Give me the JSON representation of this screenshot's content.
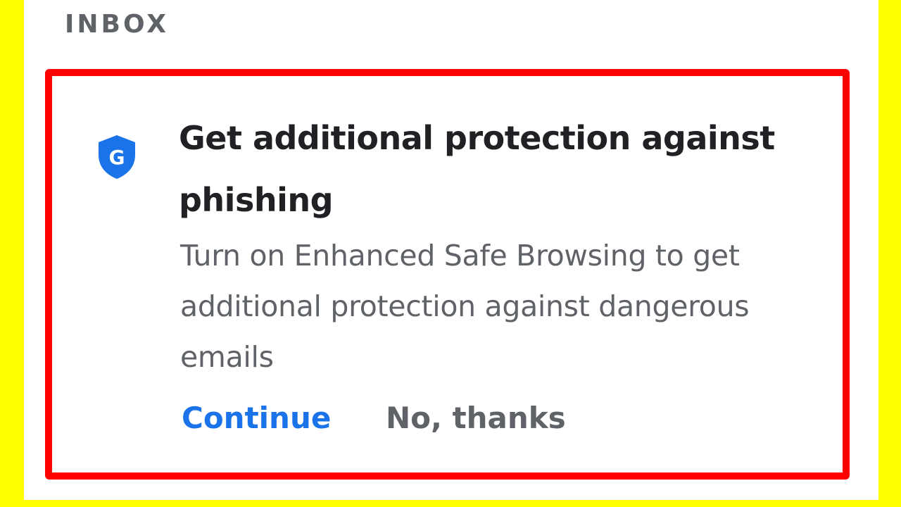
{
  "section": {
    "label": "INBOX"
  },
  "prompt": {
    "icon": "google-shield-icon",
    "icon_letter": "G",
    "title": "Get additional protection against phishing",
    "body": "Turn on Enhanced Safe Browsing to get additional protection against dangerous emails",
    "actions": {
      "continue_label": "Continue",
      "no_thanks_label": "No, thanks"
    }
  },
  "colors": {
    "background_frame": "#ffff00",
    "highlight_border": "#ff0000",
    "accent_blue": "#1a73e8",
    "title_text": "#202124",
    "secondary_text": "#5f6368"
  }
}
